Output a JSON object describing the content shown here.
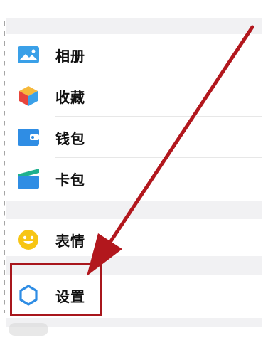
{
  "menu": {
    "group1": [
      {
        "label": "相册",
        "icon": "photo-album-icon",
        "color": "#3aa0e8"
      },
      {
        "label": "收藏",
        "icon": "favorites-cube-icon",
        "color": "#f3a52b"
      },
      {
        "label": "钱包",
        "icon": "wallet-icon",
        "color": "#2f8de4"
      },
      {
        "label": "卡包",
        "icon": "card-package-icon",
        "color": "#2bb3a3"
      }
    ],
    "group2": [
      {
        "label": "表情",
        "icon": "smiley-icon",
        "color": "#f7c514"
      }
    ],
    "group3": [
      {
        "label": "设置",
        "icon": "gear-icon",
        "color": "#2f8de4"
      }
    ]
  },
  "annotation": {
    "arrow_color": "#b2171d",
    "highlight_color": "#a8161c"
  }
}
